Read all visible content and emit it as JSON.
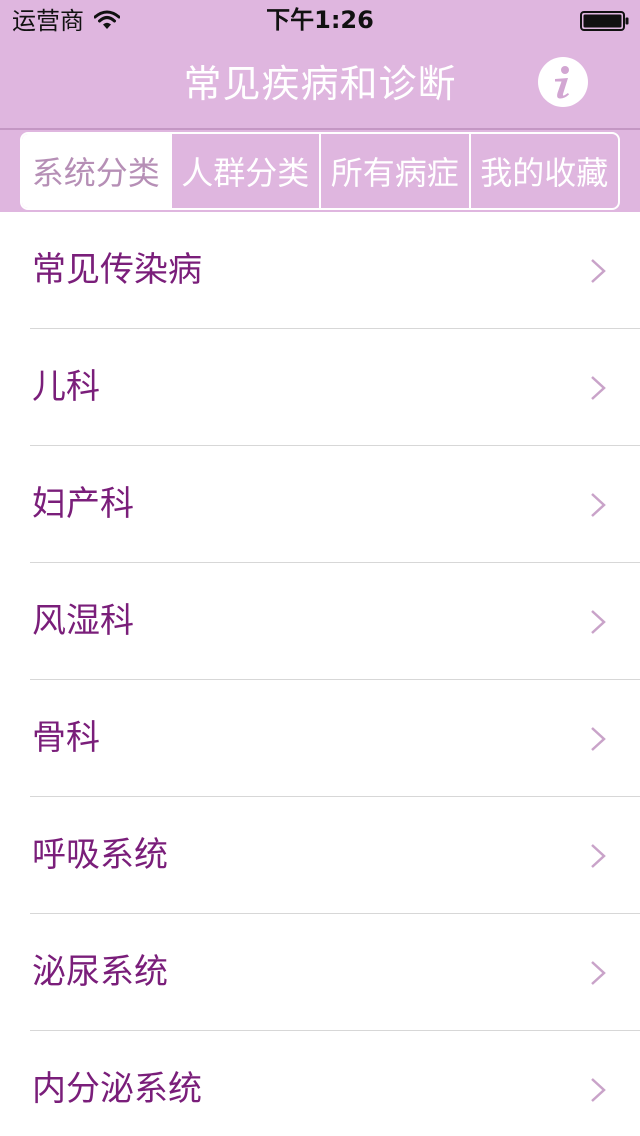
{
  "status_bar": {
    "carrier": "运营商",
    "time": "下午1:26"
  },
  "nav": {
    "title": "常见疾病和诊断",
    "info_icon": "info-icon"
  },
  "segments": [
    {
      "label": "系统分类",
      "selected": true
    },
    {
      "label": "人群分类",
      "selected": false
    },
    {
      "label": "所有病症",
      "selected": false
    },
    {
      "label": "我的收藏",
      "selected": false
    }
  ],
  "list": {
    "items": [
      {
        "label": "常见传染病"
      },
      {
        "label": "儿科"
      },
      {
        "label": "妇产科"
      },
      {
        "label": "风湿科"
      },
      {
        "label": "骨科"
      },
      {
        "label": "呼吸系统"
      },
      {
        "label": "泌尿系统"
      },
      {
        "label": "内分泌系统"
      }
    ]
  },
  "colors": {
    "bar_background": "#dfb6df",
    "item_text": "#7a1e7a",
    "chevron": "#c9a3c9"
  }
}
